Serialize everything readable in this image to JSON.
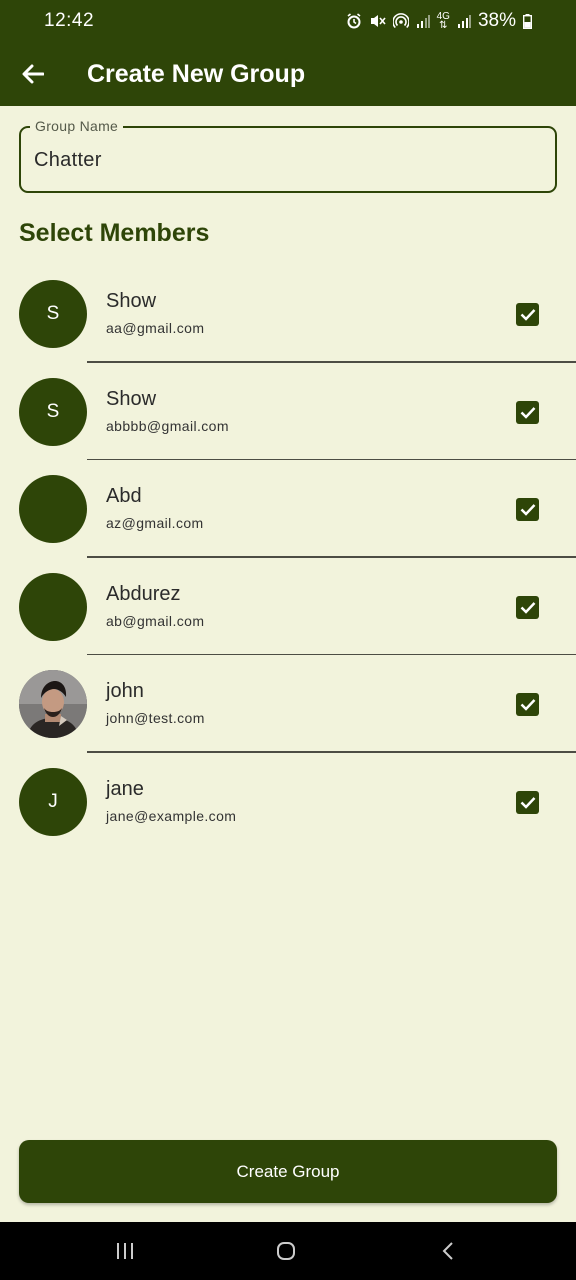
{
  "status_bar": {
    "time": "12:42",
    "battery": "38%",
    "icons": [
      "alarm-icon",
      "mute-icon",
      "hotspot-icon",
      "signal-icon",
      "4g-icon",
      "signal-icon",
      "battery-icon"
    ]
  },
  "app_bar": {
    "back_icon": "arrow-left-icon",
    "title": "Create New Group"
  },
  "group_name_field": {
    "label": "Group Name",
    "value": "Chatter"
  },
  "section_title": "Select Members",
  "members": [
    {
      "initial": "S",
      "name": "Show",
      "email": "aa@gmail.com",
      "checked": true,
      "photo": false
    },
    {
      "initial": "S",
      "name": "Show",
      "email": "abbbb@gmail.com",
      "checked": true,
      "photo": false
    },
    {
      "initial": "",
      "name": "Abd",
      "email": "az@gmail.com",
      "checked": true,
      "photo": false
    },
    {
      "initial": "",
      "name": "Abdurez",
      "email": "ab@gmail.com",
      "checked": true,
      "photo": false
    },
    {
      "initial": "",
      "name": "john",
      "email": "john@test.com",
      "checked": true,
      "photo": true
    },
    {
      "initial": "J",
      "name": "jane",
      "email": "jane@example.com",
      "checked": true,
      "photo": false
    }
  ],
  "create_button": "Create Group",
  "colors": {
    "primary": "#2E4508",
    "background": "#F2F3DC",
    "nav_bar": "#000000"
  },
  "nav_bar": {
    "icons": [
      "recents-icon",
      "home-icon",
      "back-icon"
    ]
  }
}
